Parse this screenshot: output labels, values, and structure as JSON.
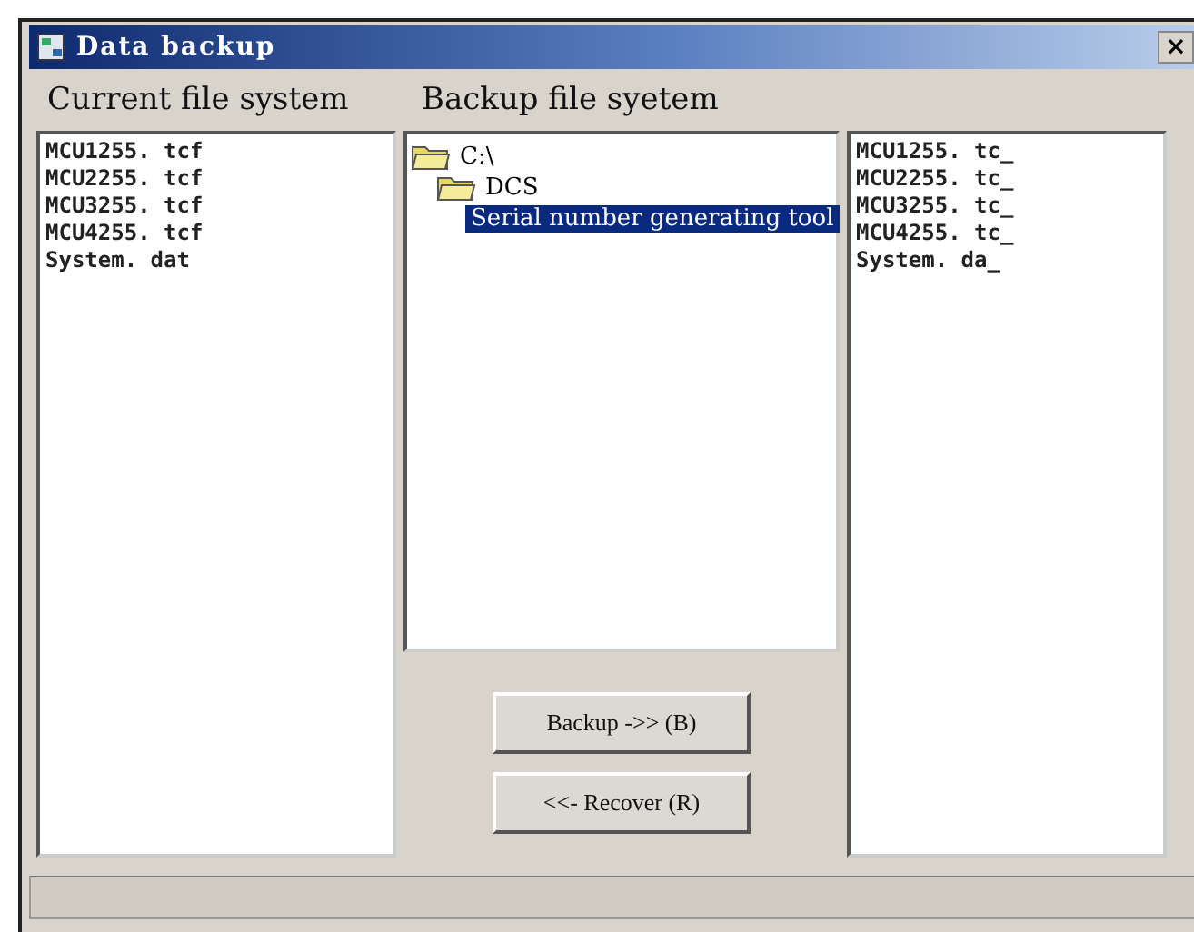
{
  "window": {
    "title": "Data backup",
    "close": "×"
  },
  "current": {
    "label": "Current file system",
    "files": [
      "MCU1255. tcf",
      "MCU2255. tcf",
      "MCU3255. tcf",
      "MCU4255. tcf",
      "System. dat"
    ]
  },
  "backup": {
    "label": "Backup file syetem",
    "tree": [
      {
        "name": "C:\\",
        "selected": false,
        "children": [
          {
            "name": "DCS",
            "selected": false,
            "children": [
              {
                "name": "Serial number generating tool",
                "selected": true
              }
            ]
          }
        ]
      }
    ],
    "files": [
      "MCU1255. tc_",
      "MCU2255. tc_",
      "MCU3255. tc_",
      "MCU4255. tc_",
      "System. da_"
    ]
  },
  "buttons": [
    {
      "label": "Backup ->> (B)"
    },
    {
      "label": "<<- Recover (R)"
    }
  ]
}
